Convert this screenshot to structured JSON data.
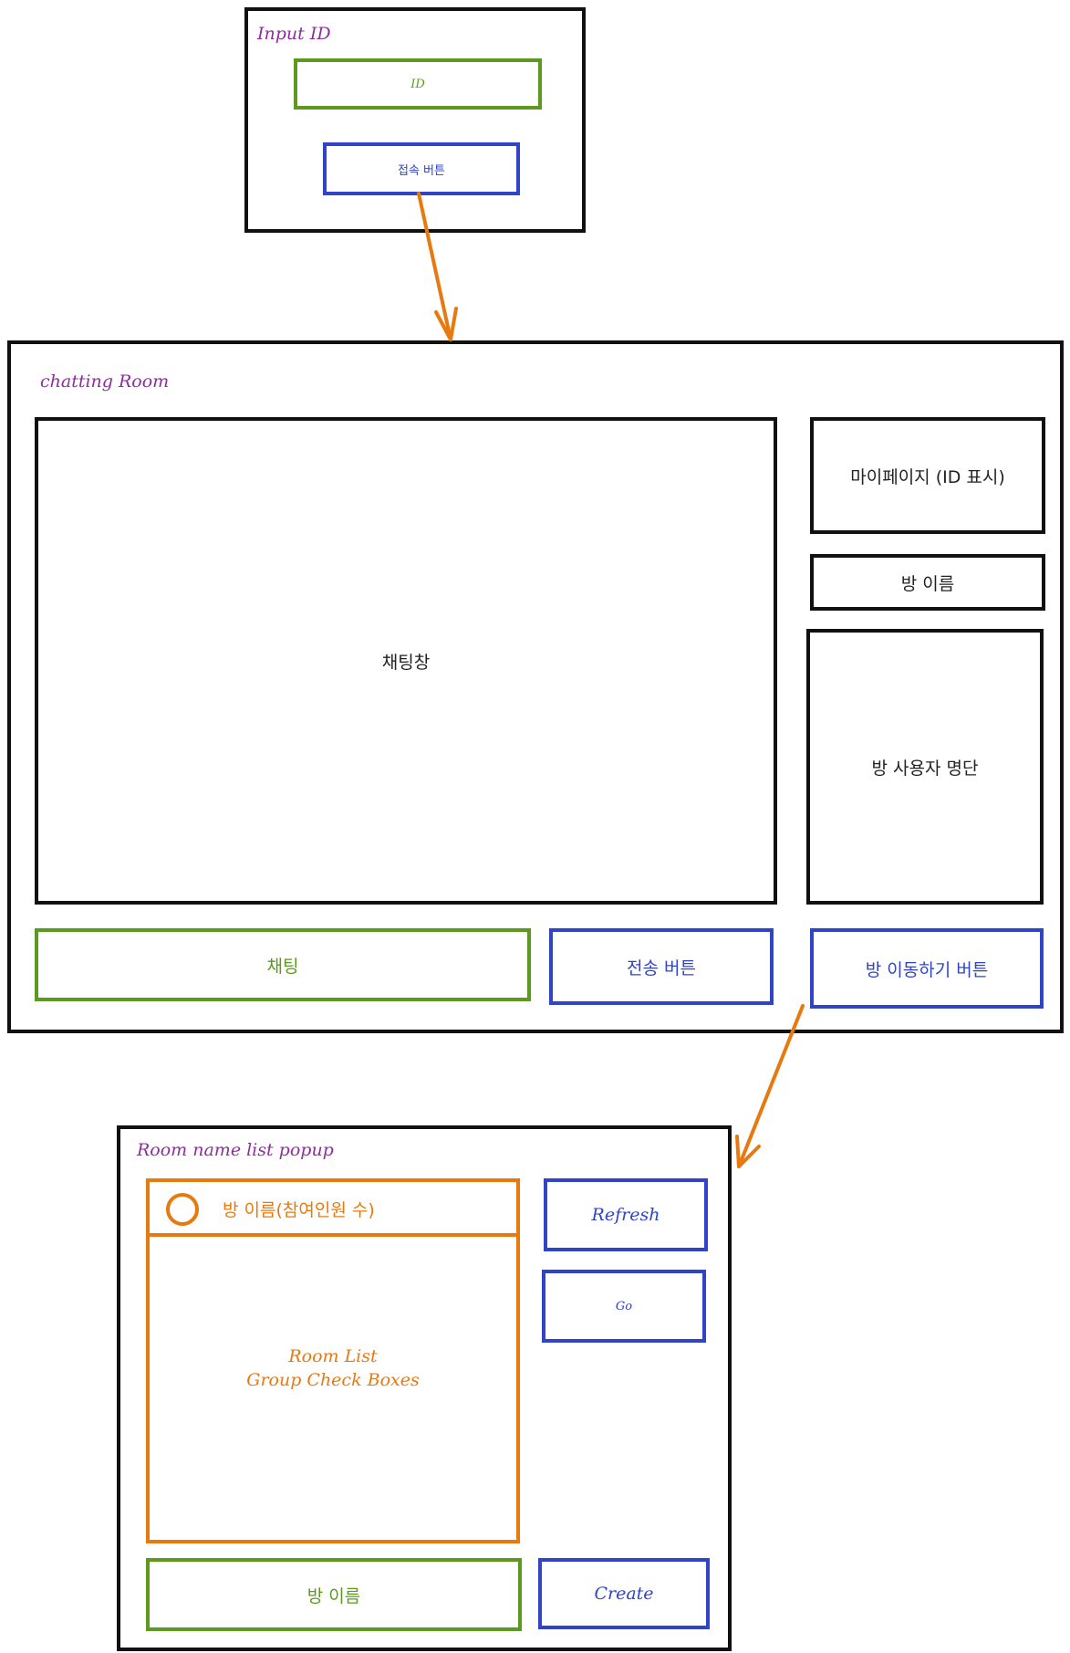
{
  "login": {
    "title": "Input ID",
    "id_field": "ID",
    "connect_button": "접속 버튼"
  },
  "chat_room": {
    "title": "chatting Room",
    "chat_window": "채팅창",
    "my_page": "마이페이지 (ID 표시)",
    "room_name": "방 이름",
    "user_list": "방 사용자 명단",
    "chat_input": "채팅",
    "send_button": "전송 버튼",
    "move_room_button": "방 이동하기 버튼"
  },
  "room_popup": {
    "title": "Room name list popup",
    "room_item": "방 이름(참여인원 수)",
    "room_list_line1": "Room List",
    "room_list_line2": "Group Check Boxes",
    "refresh_button": "Refresh",
    "go_button": "Go",
    "room_name_input": "방 이름",
    "create_button": "Create"
  },
  "colors": {
    "frame": "#111111",
    "title": "#8e2d9e",
    "input": "#5b9a1e",
    "button": "#2f44c9",
    "list": "#e8790f",
    "arrow": "#e8790f"
  }
}
